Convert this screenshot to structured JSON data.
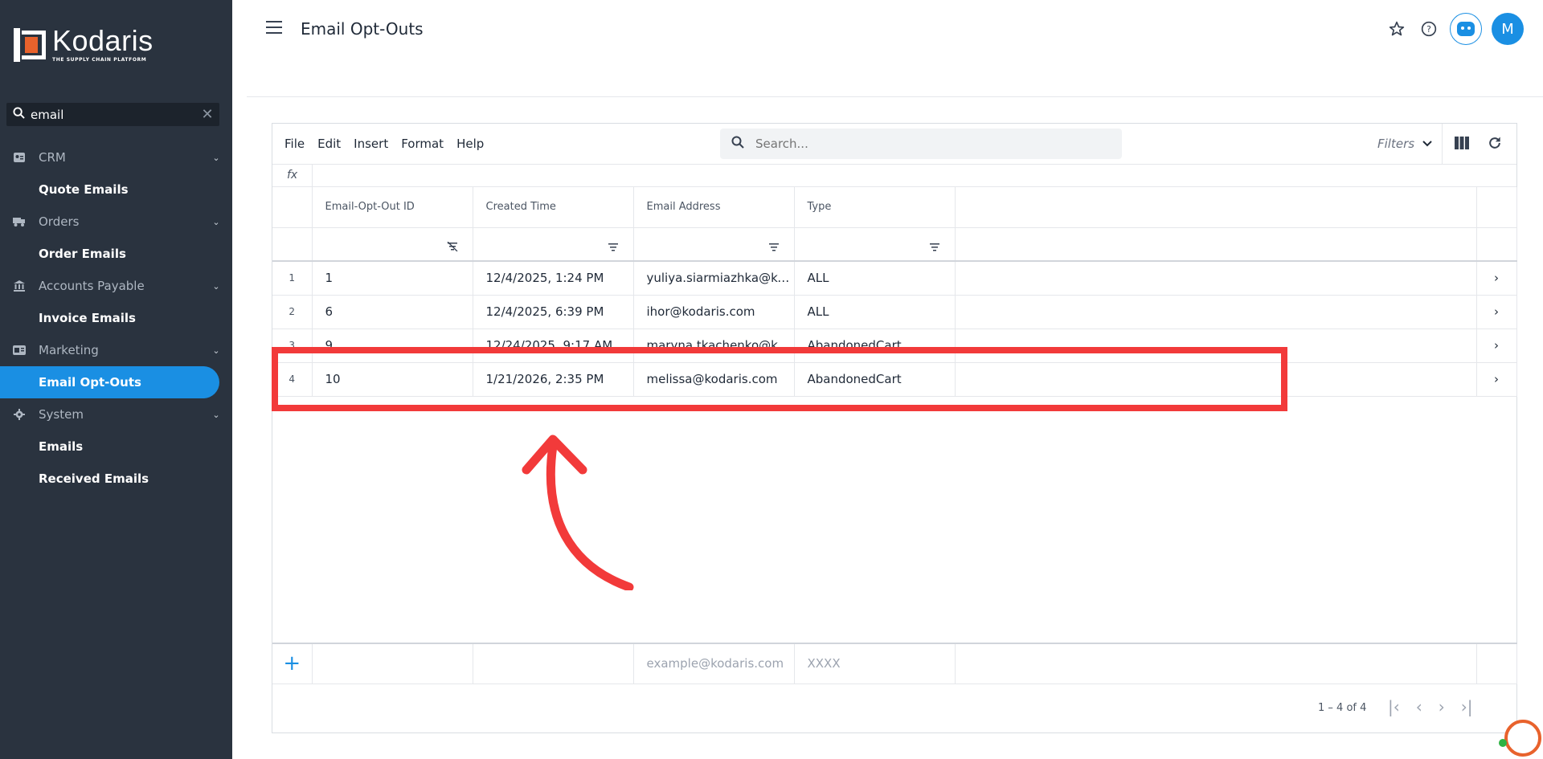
{
  "brand": {
    "name": "Kodaris",
    "tagline": "THE SUPPLY CHAIN PLATFORM",
    "accent": "#1a8fe3",
    "logo_color": "#e8622c"
  },
  "sidebar": {
    "search_value": "email",
    "groups": [
      {
        "label": "CRM",
        "icon": "address-card-icon",
        "items": [
          "Quote Emails"
        ]
      },
      {
        "label": "Orders",
        "icon": "truck-icon",
        "items": [
          "Order Emails"
        ]
      },
      {
        "label": "Accounts Payable",
        "icon": "bank-icon",
        "items": [
          "Invoice Emails"
        ]
      },
      {
        "label": "Marketing",
        "icon": "megaphone-icon",
        "items": [
          "Email Opt-Outs"
        ]
      },
      {
        "label": "System",
        "icon": "gear-icon",
        "items": [
          "Emails",
          "Received Emails"
        ]
      }
    ],
    "active_item": "Email Opt-Outs"
  },
  "header": {
    "title": "Email Opt-Outs",
    "avatar_initial": "M"
  },
  "toolbar": {
    "menu": [
      "File",
      "Edit",
      "Insert",
      "Format",
      "Help"
    ],
    "search_placeholder": "Search...",
    "filters_label": "Filters"
  },
  "formula_bar": {
    "label": "fx"
  },
  "grid": {
    "columns": [
      "Email-Opt-Out ID",
      "Created Time",
      "Email Address",
      "Type"
    ],
    "rows": [
      {
        "num": "1",
        "id": "1",
        "created": "12/4/2025, 1:24 PM",
        "email": "yuliya.siarmiazhka@kod...",
        "type": "ALL"
      },
      {
        "num": "2",
        "id": "6",
        "created": "12/4/2025, 6:39 PM",
        "email": "ihor@kodaris.com",
        "type": "ALL"
      },
      {
        "num": "3",
        "id": "9",
        "created": "12/24/2025, 9:17 AM",
        "email": "maryna.tkachenko@kodaris.com",
        "type": "AbandonedCart"
      },
      {
        "num": "4",
        "id": "10",
        "created": "1/21/2026, 2:35 PM",
        "email": "melissa@kodaris.com",
        "type": "AbandonedCart"
      }
    ],
    "new_row": {
      "email_placeholder": "example@kodaris.com",
      "type_placeholder": "XXXX"
    },
    "pagination": "1 – 4 of 4"
  },
  "annotation": {
    "highlight_color": "#f23a3a"
  }
}
